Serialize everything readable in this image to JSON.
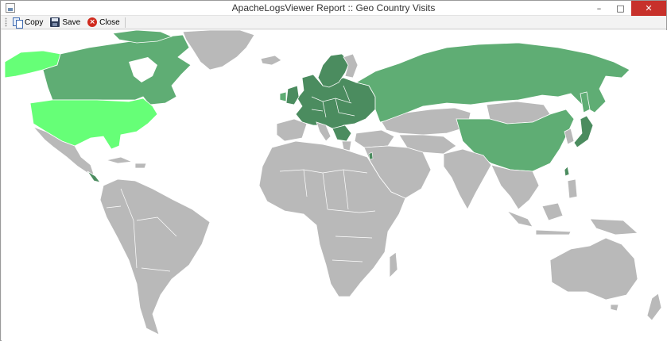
{
  "window": {
    "title": "ApacheLogsViewer Report :: Geo Country Visits",
    "controls": {
      "minimize": "–",
      "maximize": "□",
      "close": "✕"
    }
  },
  "toolbar": {
    "copy_label": "Copy",
    "save_label": "Save",
    "close_label": "Close",
    "close_glyph": "×"
  },
  "map": {
    "colors": {
      "background": "#ffffff",
      "no_data": "#b9b9b9",
      "highest": "#66ff77",
      "high": "#5fad74",
      "medium": "#4b8c5f",
      "borders": "#ffffff"
    }
  }
}
